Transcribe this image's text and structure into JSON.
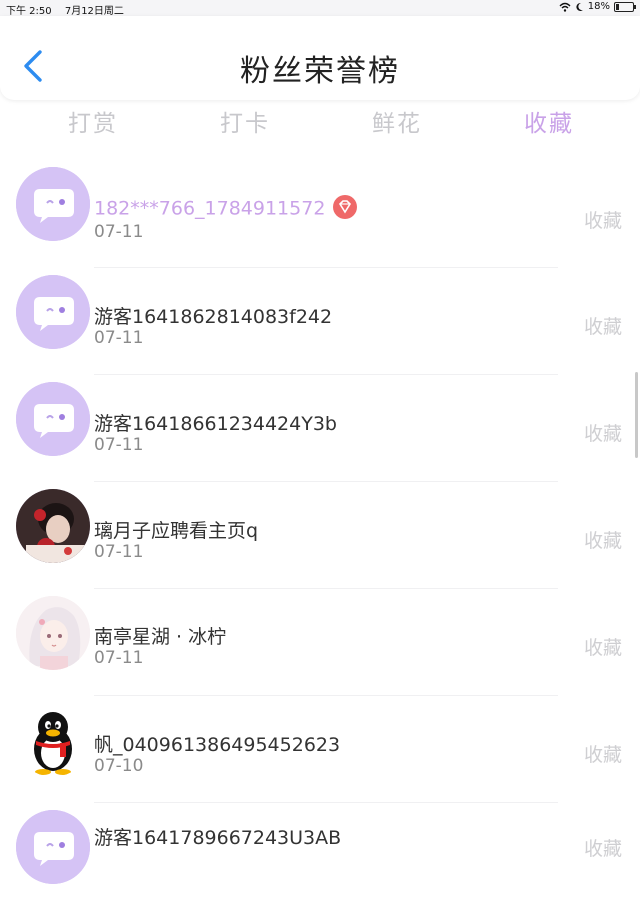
{
  "status_bar": {
    "time": "下午 2:50",
    "date": "7月12日周二",
    "battery": "18%"
  },
  "header": {
    "title": "粉丝荣誉榜"
  },
  "tabs": [
    {
      "label": "打赏",
      "active": false
    },
    {
      "label": "打卡",
      "active": false
    },
    {
      "label": "鲜花",
      "active": false
    },
    {
      "label": "收藏",
      "active": true
    }
  ],
  "colors": {
    "accent": "#c9a2e8",
    "inactive": "#c8c8cc",
    "avatar_bg": "#d5c3f5",
    "badge": "#ef6969",
    "back": "#2d8cf0"
  },
  "list": [
    {
      "name": "182***766_1784911572",
      "date": "07-11",
      "action": "收藏",
      "avatar": "chat-bubble-avatar",
      "vip": true
    },
    {
      "name": "游客1641862814083f242",
      "date": "07-11",
      "action": "收藏",
      "avatar": "chat-bubble-avatar",
      "vip": false
    },
    {
      "name": "游客16418661234424Y3b",
      "date": "07-11",
      "action": "收藏",
      "avatar": "chat-bubble-avatar",
      "vip": false
    },
    {
      "name": "璃月子应聘看主页q",
      "date": "07-11",
      "action": "收藏",
      "avatar": "photo-avatar",
      "vip": false
    },
    {
      "name": "南亭星湖 · 冰柠",
      "date": "07-11",
      "action": "收藏",
      "avatar": "anime-girl-avatar",
      "vip": false
    },
    {
      "name": "帆_040961386495452623",
      "date": "07-10",
      "action": "收藏",
      "avatar": "qq-penguin-avatar",
      "vip": false
    },
    {
      "name": "游客1641789667243U3AB",
      "date": "",
      "action": "收藏",
      "avatar": "chat-bubble-avatar",
      "vip": false
    }
  ]
}
